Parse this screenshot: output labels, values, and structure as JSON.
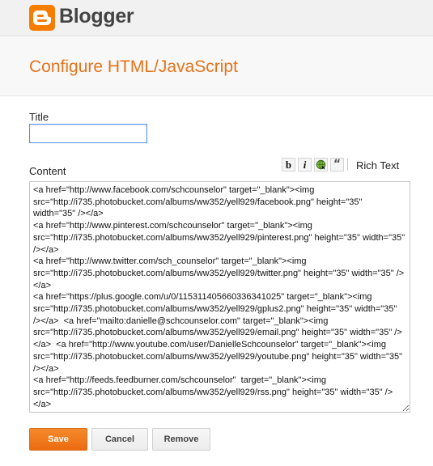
{
  "header": {
    "brand": "Blogger",
    "logo_icon": "blogger-logo-icon"
  },
  "page": {
    "title": "Configure HTML/JavaScript"
  },
  "form": {
    "title_label": "Title",
    "title_value": "",
    "content_label": "Content",
    "content_value": "<a href=\"http://www.facebook.com/schcounselor\" target=\"_blank\"><img src=\"http://i735.photobucket.com/albums/ww352/yell929/facebook.png\" height=\"35\" width=\"35\" /></a>\n<a href=\"http://www.pinterest.com/schcounselor\" target=\"_blank\"><img src=\"http://i735.photobucket.com/albums/ww352/yell929/pinterest.png\" height=\"35\" width=\"35\" /></a>\n<a href=\"http://www.twitter.com/sch_counselor\" target=\"_blank\"><img src=\"http://i735.photobucket.com/albums/ww352/yell929/twitter.png\" height=\"35\" width=\"35\" /></a>\n<a href=\"https://plus.google.com/u/0/115311405660336341025\" target=\"_blank\"><img src=\"http://i735.photobucket.com/albums/ww352/yell929/gplus2.png\" height=\"35\" width=\"35\" /></a>  <a href=\"mailto:danielle@schcounselor.com\" target=\"_blank\"><img src=\"http://i735.photobucket.com/albums/ww352/yell929/email.png\" height=\"35\" width=\"35\" /></a>  <a href=\"http://www.youtube.com/user/DanielleSchcounselor\" target=\"_blank\"><img src=\"http://i735.photobucket.com/albums/ww352/yell929/youtube.png\" height=\"35\" width=\"35\" /></a>\n<a href=\"http://feeds.feedburner.com/schcounselor\"  target=\"_blank\"><img src=\"http://i735.photobucket.com/albums/ww352/yell929/rss.png\" height=\"35\" width=\"35\" /></a>"
  },
  "toolbar": {
    "bold_label": "b",
    "italic_label": "i",
    "quote_label": "“",
    "rich_text_label": "Rich Text"
  },
  "actions": {
    "save_label": "Save",
    "cancel_label": "Cancel",
    "remove_label": "Remove"
  },
  "colors": {
    "accent": "#e3741c",
    "logo": "#f57d00",
    "focus_border": "#4d90fe"
  }
}
